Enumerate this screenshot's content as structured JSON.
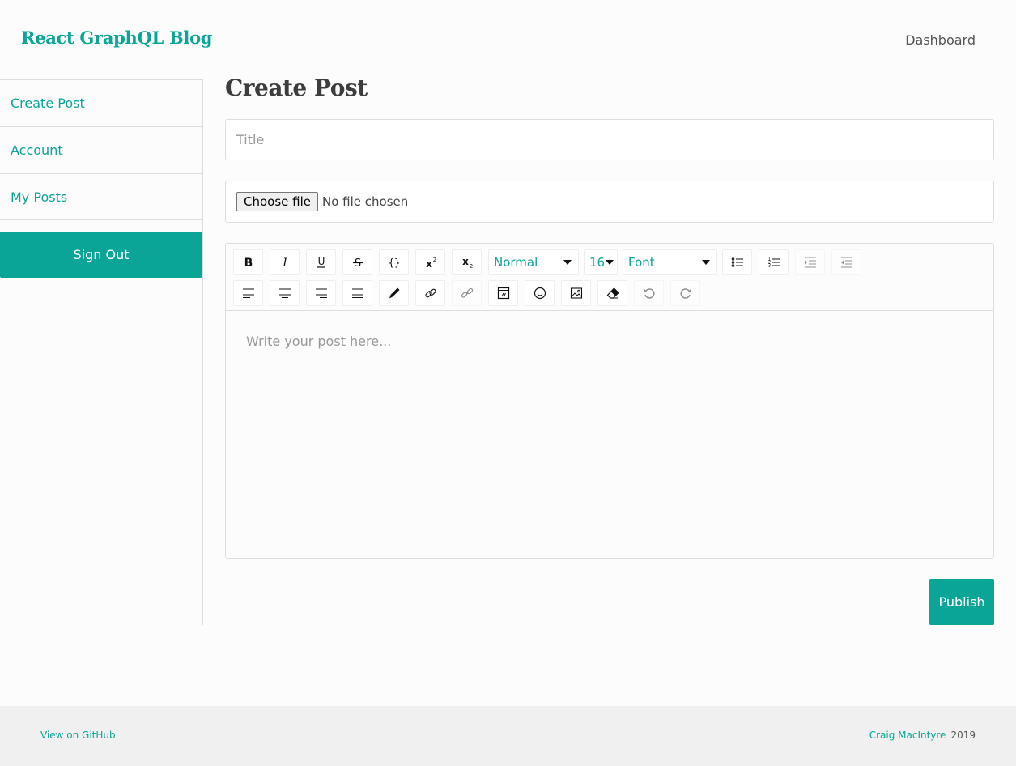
{
  "header": {
    "brand": "React GraphQL Blog",
    "nav_dashboard": "Dashboard"
  },
  "sidebar": {
    "items": [
      {
        "label": "Create Post"
      },
      {
        "label": "Account"
      },
      {
        "label": "My Posts"
      }
    ],
    "signout_label": "Sign Out"
  },
  "main": {
    "title": "Create Post",
    "title_placeholder": "Title",
    "file_button": "Choose file",
    "file_status": "No file chosen",
    "editor": {
      "block_type": "Normal",
      "font_size": "16",
      "font_family": "Font",
      "placeholder": "Write your post here..."
    },
    "publish_label": "Publish"
  },
  "footer": {
    "github_link": "View on GitHub",
    "author": "Craig MacIntyre",
    "year": "2019"
  },
  "colors": {
    "accent": "#0aa596",
    "footer_bg": "#f0f0f0",
    "border": "#dddddd"
  },
  "icons": {
    "toolbar_row1": [
      "bold-icon",
      "italic-icon",
      "underline-icon",
      "strikethrough-icon",
      "code-icon",
      "superscript-icon",
      "subscript-icon",
      "unordered-list-icon",
      "ordered-list-icon",
      "indent-icon",
      "outdent-icon"
    ],
    "toolbar_row2": [
      "align-left-icon",
      "align-center-icon",
      "align-right-icon",
      "align-justify-icon",
      "color-picker-icon",
      "link-icon",
      "unlink-icon",
      "embed-icon",
      "emoji-icon",
      "image-icon",
      "eraser-icon",
      "undo-icon",
      "redo-icon"
    ]
  }
}
